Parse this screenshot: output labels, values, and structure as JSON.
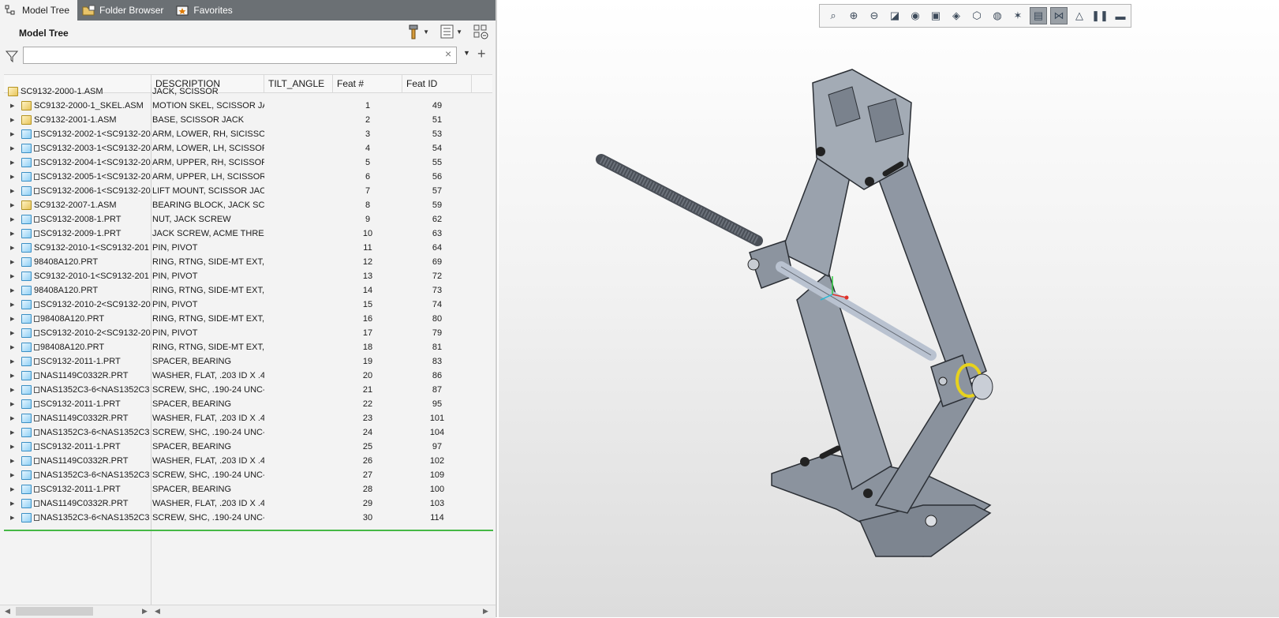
{
  "tabs": [
    {
      "label": "Model Tree",
      "icon": "model-tree-icon"
    },
    {
      "label": "Folder Browser",
      "icon": "folder-browser-icon"
    },
    {
      "label": "Favorites",
      "icon": "favorites-icon"
    }
  ],
  "panel": {
    "title": "Model Tree"
  },
  "filter": {
    "placeholder": "",
    "value": ""
  },
  "columns": [
    "",
    "DESCRIPTION",
    "TILT_ANGLE",
    "Feat #",
    "Feat ID"
  ],
  "rows": [
    {
      "name": "SC9132-2000-1.ASM",
      "desc": "JACK, SCISSOR",
      "feat": "",
      "id": "",
      "type": "asm",
      "root": true
    },
    {
      "name": "SC9132-2000-1_SKEL.ASM",
      "desc": "MOTION SKEL, SCISSOR JAC",
      "feat": "1",
      "id": "49",
      "type": "skel"
    },
    {
      "name": "SC9132-2001-1.ASM",
      "desc": "BASE, SCISSOR JACK",
      "feat": "2",
      "id": "51",
      "type": "asm"
    },
    {
      "name": "SC9132-2002-1<SC9132-20",
      "desc": "ARM, LOWER, RH, SICISSOR",
      "feat": "3",
      "id": "53",
      "type": "prt",
      "link": true
    },
    {
      "name": "SC9132-2003-1<SC9132-20",
      "desc": "ARM, LOWER, LH, SCISSOR",
      "feat": "4",
      "id": "54",
      "type": "prt",
      "link": true
    },
    {
      "name": "SC9132-2004-1<SC9132-20",
      "desc": "ARM, UPPER, RH, SCISSOR J",
      "feat": "5",
      "id": "55",
      "type": "prt",
      "link": true
    },
    {
      "name": "SC9132-2005-1<SC9132-20",
      "desc": "ARM, UPPER, LH, SCISSOR J",
      "feat": "6",
      "id": "56",
      "type": "prt",
      "link": true
    },
    {
      "name": "SC9132-2006-1<SC9132-20",
      "desc": "LIFT MOUNT, SCISSOR JACK",
      "feat": "7",
      "id": "57",
      "type": "prt",
      "link": true
    },
    {
      "name": "SC9132-2007-1.ASM",
      "desc": "BEARING BLOCK, JACK SCRE",
      "feat": "8",
      "id": "59",
      "type": "asm"
    },
    {
      "name": "SC9132-2008-1.PRT",
      "desc": "NUT, JACK SCREW",
      "feat": "9",
      "id": "62",
      "type": "prt",
      "link": true
    },
    {
      "name": "SC9132-2009-1.PRT",
      "desc": "JACK SCREW, ACME THREAD",
      "feat": "10",
      "id": "63",
      "type": "prt",
      "link": true
    },
    {
      "name": "SC9132-2010-1<SC9132-201",
      "desc": "PIN, PIVOT",
      "feat": "11",
      "id": "64",
      "type": "prt"
    },
    {
      "name": "98408A120.PRT",
      "desc": "RING, RTNG, SIDE-MT EXT, .",
      "feat": "12",
      "id": "69",
      "type": "prt"
    },
    {
      "name": "SC9132-2010-1<SC9132-201",
      "desc": "PIN, PIVOT",
      "feat": "13",
      "id": "72",
      "type": "prt"
    },
    {
      "name": "98408A120.PRT",
      "desc": "RING, RTNG, SIDE-MT EXT, .",
      "feat": "14",
      "id": "73",
      "type": "prt"
    },
    {
      "name": "SC9132-2010-2<SC9132-20",
      "desc": "PIN, PIVOT",
      "feat": "15",
      "id": "74",
      "type": "prt",
      "link": true
    },
    {
      "name": "98408A120.PRT",
      "desc": "RING, RTNG, SIDE-MT EXT, .",
      "feat": "16",
      "id": "80",
      "type": "prt",
      "link": true
    },
    {
      "name": "SC9132-2010-2<SC9132-20",
      "desc": "PIN, PIVOT",
      "feat": "17",
      "id": "79",
      "type": "prt",
      "link": true
    },
    {
      "name": "98408A120.PRT",
      "desc": "RING, RTNG, SIDE-MT EXT, .",
      "feat": "18",
      "id": "81",
      "type": "prt",
      "link": true
    },
    {
      "name": "SC9132-2011-1.PRT",
      "desc": "SPACER, BEARING",
      "feat": "19",
      "id": "83",
      "type": "prt",
      "link": true
    },
    {
      "name": "NAS1149C0332R.PRT",
      "desc": "WASHER, FLAT, .203 ID X .43",
      "feat": "20",
      "id": "86",
      "type": "prt",
      "link": true
    },
    {
      "name": "NAS1352C3-6<NAS1352C3",
      "desc": "SCREW, SHC, .190-24 UNC-3",
      "feat": "21",
      "id": "87",
      "type": "prt",
      "link": true
    },
    {
      "name": "SC9132-2011-1.PRT",
      "desc": "SPACER, BEARING",
      "feat": "22",
      "id": "95",
      "type": "prt",
      "link": true
    },
    {
      "name": "NAS1149C0332R.PRT",
      "desc": "WASHER, FLAT, .203 ID X .43",
      "feat": "23",
      "id": "101",
      "type": "prt",
      "link": true
    },
    {
      "name": "NAS1352C3-6<NAS1352C3",
      "desc": "SCREW, SHC, .190-24 UNC-3",
      "feat": "24",
      "id": "104",
      "type": "prt",
      "link": true
    },
    {
      "name": "SC9132-2011-1.PRT",
      "desc": "SPACER, BEARING",
      "feat": "25",
      "id": "97",
      "type": "prt",
      "link": true
    },
    {
      "name": "NAS1149C0332R.PRT",
      "desc": "WASHER, FLAT, .203 ID X .43",
      "feat": "26",
      "id": "102",
      "type": "prt",
      "link": true
    },
    {
      "name": "NAS1352C3-6<NAS1352C3",
      "desc": "SCREW, SHC, .190-24 UNC-3",
      "feat": "27",
      "id": "109",
      "type": "prt",
      "link": true
    },
    {
      "name": "SC9132-2011-1.PRT",
      "desc": "SPACER, BEARING",
      "feat": "28",
      "id": "100",
      "type": "prt",
      "link": true
    },
    {
      "name": "NAS1149C0332R.PRT",
      "desc": "WASHER, FLAT, .203 ID X .43",
      "feat": "29",
      "id": "103",
      "type": "prt",
      "link": true
    },
    {
      "name": "NAS1352C3-6<NAS1352C3",
      "desc": "SCREW, SHC, .190-24 UNC-3",
      "feat": "30",
      "id": "114",
      "type": "prt",
      "link": true
    }
  ],
  "view_toolbar": [
    "refit-icon",
    "zoom-in-icon",
    "zoom-out-icon",
    "repaint-icon",
    "display-style-icon",
    "saved-orientations-icon",
    "view-manager-icon",
    "perspective-icon",
    "section-icon",
    "datum-display-icon",
    "annotation-display-icon",
    "spin-center-icon",
    "hidden-line-icon",
    "pause-icon",
    "stop-icon"
  ],
  "colors": {
    "tab_bar": "#6b7074",
    "accent_green": "#45b845",
    "model_gray": "#8f97a3"
  }
}
